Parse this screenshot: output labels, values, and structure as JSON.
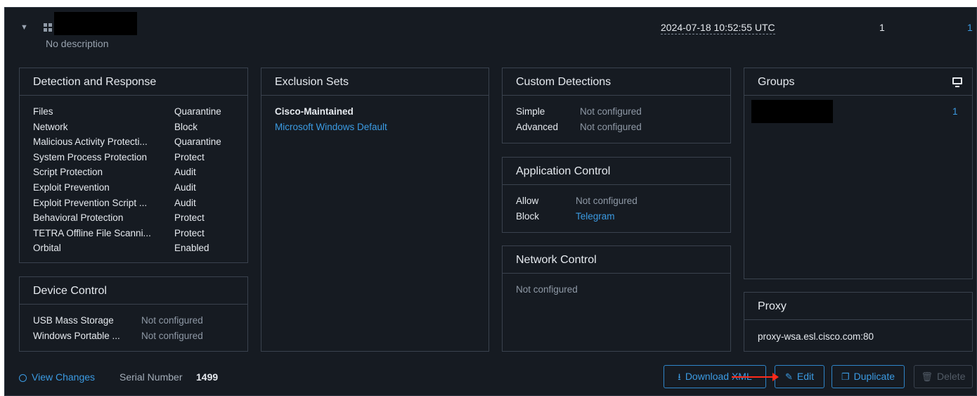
{
  "header": {
    "toggle_icon": "chevron-down-icon",
    "os_icon": "windows-icon",
    "description": "No description",
    "modified": "2024-07-18 10:52:55 UTC",
    "count": "1",
    "link_count": "1"
  },
  "detection_response": {
    "title": "Detection and Response",
    "rows": [
      {
        "label": "Files",
        "value": "Quarantine"
      },
      {
        "label": "Network",
        "value": "Block"
      },
      {
        "label": "Malicious Activity Protecti...",
        "value": "Quarantine"
      },
      {
        "label": "System Process Protection",
        "value": "Protect"
      },
      {
        "label": "Script Protection",
        "value": "Audit"
      },
      {
        "label": "Exploit Prevention",
        "value": "Audit"
      },
      {
        "label": "Exploit Prevention Script ...",
        "value": "Audit"
      },
      {
        "label": "Behavioral Protection",
        "value": "Protect"
      },
      {
        "label": "TETRA Offline File Scanni...",
        "value": "Protect"
      },
      {
        "label": "Orbital",
        "value": "Enabled"
      }
    ]
  },
  "device_control": {
    "title": "Device Control",
    "rows": [
      {
        "label": "USB Mass Storage",
        "value": "Not configured"
      },
      {
        "label": "Windows Portable ...",
        "value": "Not configured"
      }
    ]
  },
  "exclusion_sets": {
    "title": "Exclusion Sets",
    "group_label": "Cisco-Maintained",
    "item": "Microsoft Windows Default"
  },
  "custom_detections": {
    "title": "Custom Detections",
    "rows": [
      {
        "label": "Simple",
        "value": "Not configured"
      },
      {
        "label": "Advanced",
        "value": "Not configured"
      }
    ]
  },
  "application_control": {
    "title": "Application Control",
    "rows": [
      {
        "label": "Allow",
        "value": "Not configured"
      },
      {
        "label": "Block",
        "value": "Telegram"
      }
    ]
  },
  "network_control": {
    "title": "Network Control",
    "status": "Not configured"
  },
  "groups": {
    "title": "Groups",
    "icon": "monitor-icon",
    "count": "1"
  },
  "proxy": {
    "title": "Proxy",
    "value": "proxy-wsa.esl.cisco.com:80"
  },
  "footer": {
    "view_changes": "View Changes",
    "serial_label": "Serial Number",
    "serial_value": "1499",
    "download_label": "Download XML",
    "edit_label": "Edit",
    "duplicate_label": "Duplicate",
    "delete_label": "Delete"
  },
  "colors": {
    "background": "#161b22",
    "border": "#3a424e",
    "accent": "#3b9be3",
    "annotation_arrow": "#ff2a1a"
  }
}
